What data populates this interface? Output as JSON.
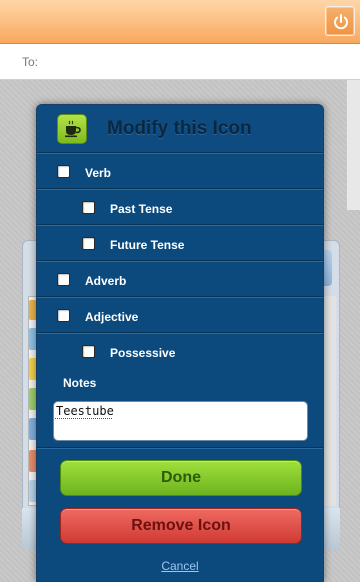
{
  "compose": {
    "to_label": "To:",
    "to_value": ""
  },
  "topbar": {
    "power_icon": "power-icon",
    "accent": "#f8a85e"
  },
  "modal": {
    "title": "Modify this Icon",
    "icon": "coffee-cup-icon",
    "options": [
      {
        "label": "Verb",
        "checked": false,
        "indent": false
      },
      {
        "label": "Past Tense",
        "checked": false,
        "indent": true
      },
      {
        "label": "Future Tense",
        "checked": false,
        "indent": true
      },
      {
        "label": "Adverb",
        "checked": false,
        "indent": false
      },
      {
        "label": "Adjective",
        "checked": false,
        "indent": false
      },
      {
        "label": "Possessive",
        "checked": false,
        "indent": true
      }
    ],
    "notes_label": "Notes",
    "notes_value": "Teestube",
    "done_label": "Done",
    "remove_label": "Remove Icon",
    "cancel_label": "Cancel",
    "colors": {
      "panel": "#0c4a7e",
      "done": "#7dc326",
      "remove": "#d9463e",
      "cancel_link": "#9cc6ee"
    }
  }
}
